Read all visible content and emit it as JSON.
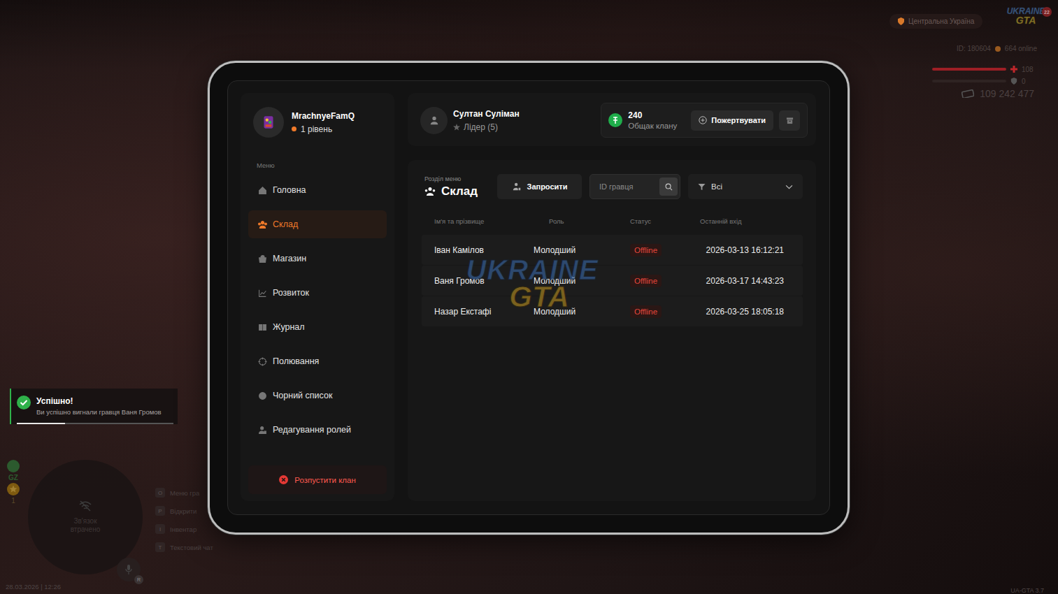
{
  "hud": {
    "region": "Центральна Україна",
    "logo": {
      "line1": "UKRAINE",
      "line2": "GTA",
      "badge": "22"
    },
    "player_id": "ID: 180604",
    "online": "664 online",
    "health": {
      "value": "108",
      "level": 1
    },
    "armor": {
      "value": "0",
      "level": 0
    },
    "money": "109 242 477"
  },
  "notification": {
    "title": "Успішно!",
    "message": "Ви успішно вигнали гравця Ваня Громов",
    "level": 0.31
  },
  "minimap": {
    "text": "Зв'язок втрачено",
    "zone": "GZ",
    "wanted": "1"
  },
  "hotkeys": [
    {
      "key": "O",
      "label": "Меню гра"
    },
    {
      "key": "P",
      "label": "Відкрити"
    },
    {
      "key": "I",
      "label": "Інвентар"
    },
    {
      "key": "T",
      "label": "Текстовий чат"
    }
  ],
  "mic_key": "R",
  "datetime": "28.03.2026 | 12:26",
  "version": "UA-GTA 3.7",
  "tablet": {
    "profile": {
      "name": "MrachnyeFamQ",
      "level": "1 рівень"
    },
    "menu_label": "Меню",
    "sidebar": {
      "items": [
        {
          "label": "Головна",
          "selected": false
        },
        {
          "label": "Склад",
          "selected": true
        },
        {
          "label": "Магазин",
          "selected": false
        },
        {
          "label": "Розвиток",
          "selected": false
        },
        {
          "label": "Журнал",
          "selected": false
        },
        {
          "label": "Полювання",
          "selected": false
        },
        {
          "label": "Чорний список",
          "selected": false
        },
        {
          "label": "Редагування ролей",
          "selected": false
        }
      ]
    },
    "disband_button": "Розпустити клан",
    "leader": {
      "name": "Султан Суліман",
      "role": "Лідер (5)"
    },
    "treasury": {
      "amount": "240",
      "label": "Общак клану",
      "donate_button": "Пожертвувати"
    },
    "section": {
      "caption": "Розділ меню",
      "title": "Склад"
    },
    "invite_button": "Запросити",
    "search": {
      "placeholder": "ID гравця"
    },
    "filter": {
      "value": "Всі"
    },
    "table": {
      "columns": [
        "Ім'я та прізвище",
        "Роль",
        "Статус",
        "Останній вхід"
      ],
      "rows": [
        {
          "name": "Іван Камілов",
          "role": "Молодший",
          "status": "Offline",
          "online": false,
          "last_login": "2026-03-13 16:12:21"
        },
        {
          "name": "Ваня Громов",
          "role": "Молодший",
          "status": "Offline",
          "online": false,
          "last_login": "2026-03-17 14:43:23"
        },
        {
          "name": "Назар Екстафі",
          "role": "Молодший",
          "status": "Offline",
          "online": false,
          "last_login": "2026-03-25 18:05:18"
        }
      ]
    },
    "watermark": {
      "line1": "UKRAINE",
      "line2": "GTA"
    }
  }
}
